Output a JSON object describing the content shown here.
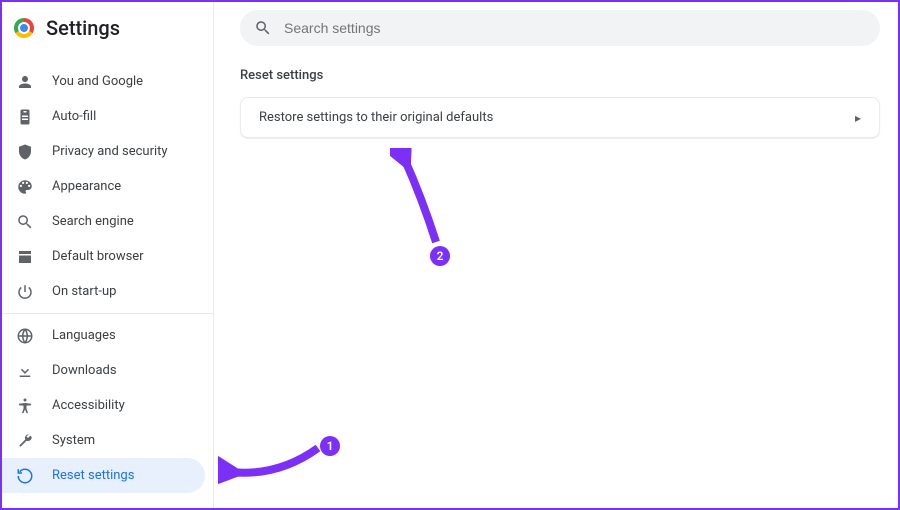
{
  "header": {
    "title": "Settings"
  },
  "search": {
    "placeholder": "Search settings"
  },
  "sidebar": {
    "groups": [
      {
        "items": [
          {
            "label": "You and Google",
            "icon": "person"
          },
          {
            "label": "Auto-fill",
            "icon": "clipboard"
          },
          {
            "label": "Privacy and security",
            "icon": "shield"
          },
          {
            "label": "Appearance",
            "icon": "palette"
          },
          {
            "label": "Search engine",
            "icon": "search"
          },
          {
            "label": "Default browser",
            "icon": "window"
          },
          {
            "label": "On start-up",
            "icon": "power"
          }
        ]
      },
      {
        "items": [
          {
            "label": "Languages",
            "icon": "globe"
          },
          {
            "label": "Downloads",
            "icon": "download"
          },
          {
            "label": "Accessibility",
            "icon": "accessibility"
          },
          {
            "label": "System",
            "icon": "wrench"
          },
          {
            "label": "Reset settings",
            "icon": "reset",
            "selected": true
          }
        ]
      }
    ]
  },
  "main": {
    "section_title": "Reset settings",
    "card_label": "Restore settings to their original defaults"
  },
  "annotations": {
    "badge1": "1",
    "badge2": "2"
  },
  "colors": {
    "accent": "#1a73e8",
    "highlight": "#7b2ff7"
  }
}
